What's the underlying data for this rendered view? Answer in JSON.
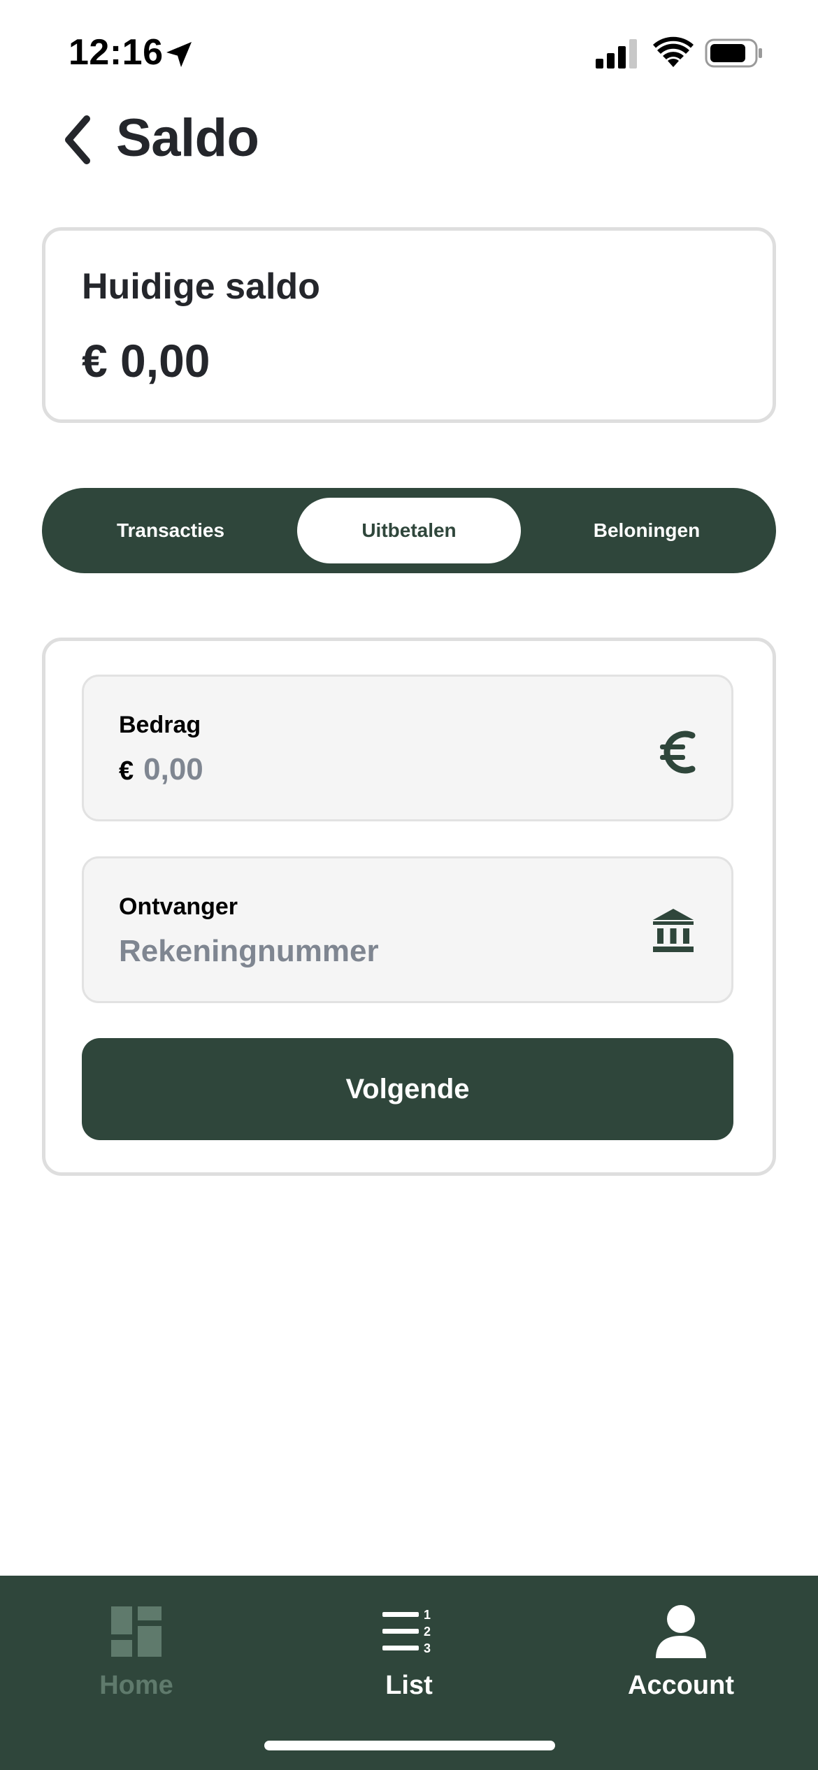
{
  "status_bar": {
    "time": "12:16",
    "icons": [
      "location-arrow-icon",
      "cellular-signal-icon",
      "wifi-icon",
      "battery-icon"
    ]
  },
  "header": {
    "title": "Saldo",
    "back_icon": "chevron-left-icon"
  },
  "balance": {
    "label": "Huidige saldo",
    "value": "€ 0,00"
  },
  "tabs": [
    {
      "label": "Transacties",
      "active": false
    },
    {
      "label": "Uitbetalen",
      "active": true
    },
    {
      "label": "Beloningen",
      "active": false
    }
  ],
  "form": {
    "amount": {
      "label": "Bedrag",
      "currency": "€",
      "placeholder": "0,00",
      "icon": "euro-icon"
    },
    "recipient": {
      "label": "Ontvanger",
      "placeholder": "Rekeningnummer",
      "icon": "bank-icon"
    },
    "submit_label": "Volgende"
  },
  "bottom_nav": {
    "items": [
      {
        "label": "Home",
        "icon": "dashboard-grid-icon",
        "active": false
      },
      {
        "label": "List",
        "icon": "numbered-list-icon",
        "active": true
      },
      {
        "label": "Account",
        "icon": "user-icon",
        "active": true
      }
    ]
  },
  "colors": {
    "brand_dark_green": "#2f463b",
    "card_border": "#dedede",
    "field_background": "#f5f5f5",
    "placeholder_gray": "#7f8691",
    "inactive_nav": "#5f7a6c"
  }
}
